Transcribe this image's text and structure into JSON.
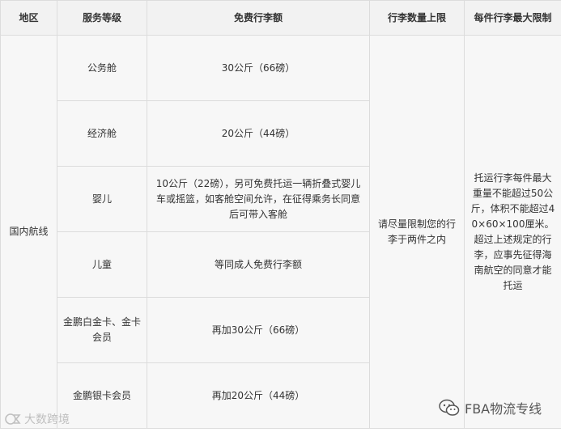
{
  "table": {
    "headers": [
      "地区",
      "服务等级",
      "免费行李额",
      "行李数量上限",
      "每件行李最大限制"
    ],
    "region": "国内航线",
    "rows": [
      {
        "level": "公务舱",
        "allowance": "30公斤（66磅）"
      },
      {
        "level": "经济舱",
        "allowance": "20公斤（44磅）"
      },
      {
        "level": "婴儿",
        "allowance": "10公斤（22磅），另可免费托运一辆折叠式婴儿车或摇篮，如客舱空间允许，在征得乘务长同意后可带入客舱"
      },
      {
        "level": "儿童",
        "allowance": "等同成人免费行李额"
      },
      {
        "level": "金鹏白金卡、金卡会员",
        "allowance": "再加30公斤（66磅）"
      },
      {
        "level": "金鹏银卡会员",
        "allowance": "再加20公斤（44磅）"
      }
    ],
    "quantity_limit": "请尽量限制您的行李于两件之内",
    "max_limit": "托运行李每件最大重量不能超过50公斤，体积不能超过40×60×100厘米。超过上述规定的行李，应事先征得海南航空的同意才能托运"
  },
  "watermarks": {
    "left_text": "大数跨境",
    "right_text": "FBA物流专线"
  },
  "colors": {
    "header_bg": "#f2f2f2",
    "cell_bg": "#f7f7f7",
    "border": "#dcdcdc"
  }
}
